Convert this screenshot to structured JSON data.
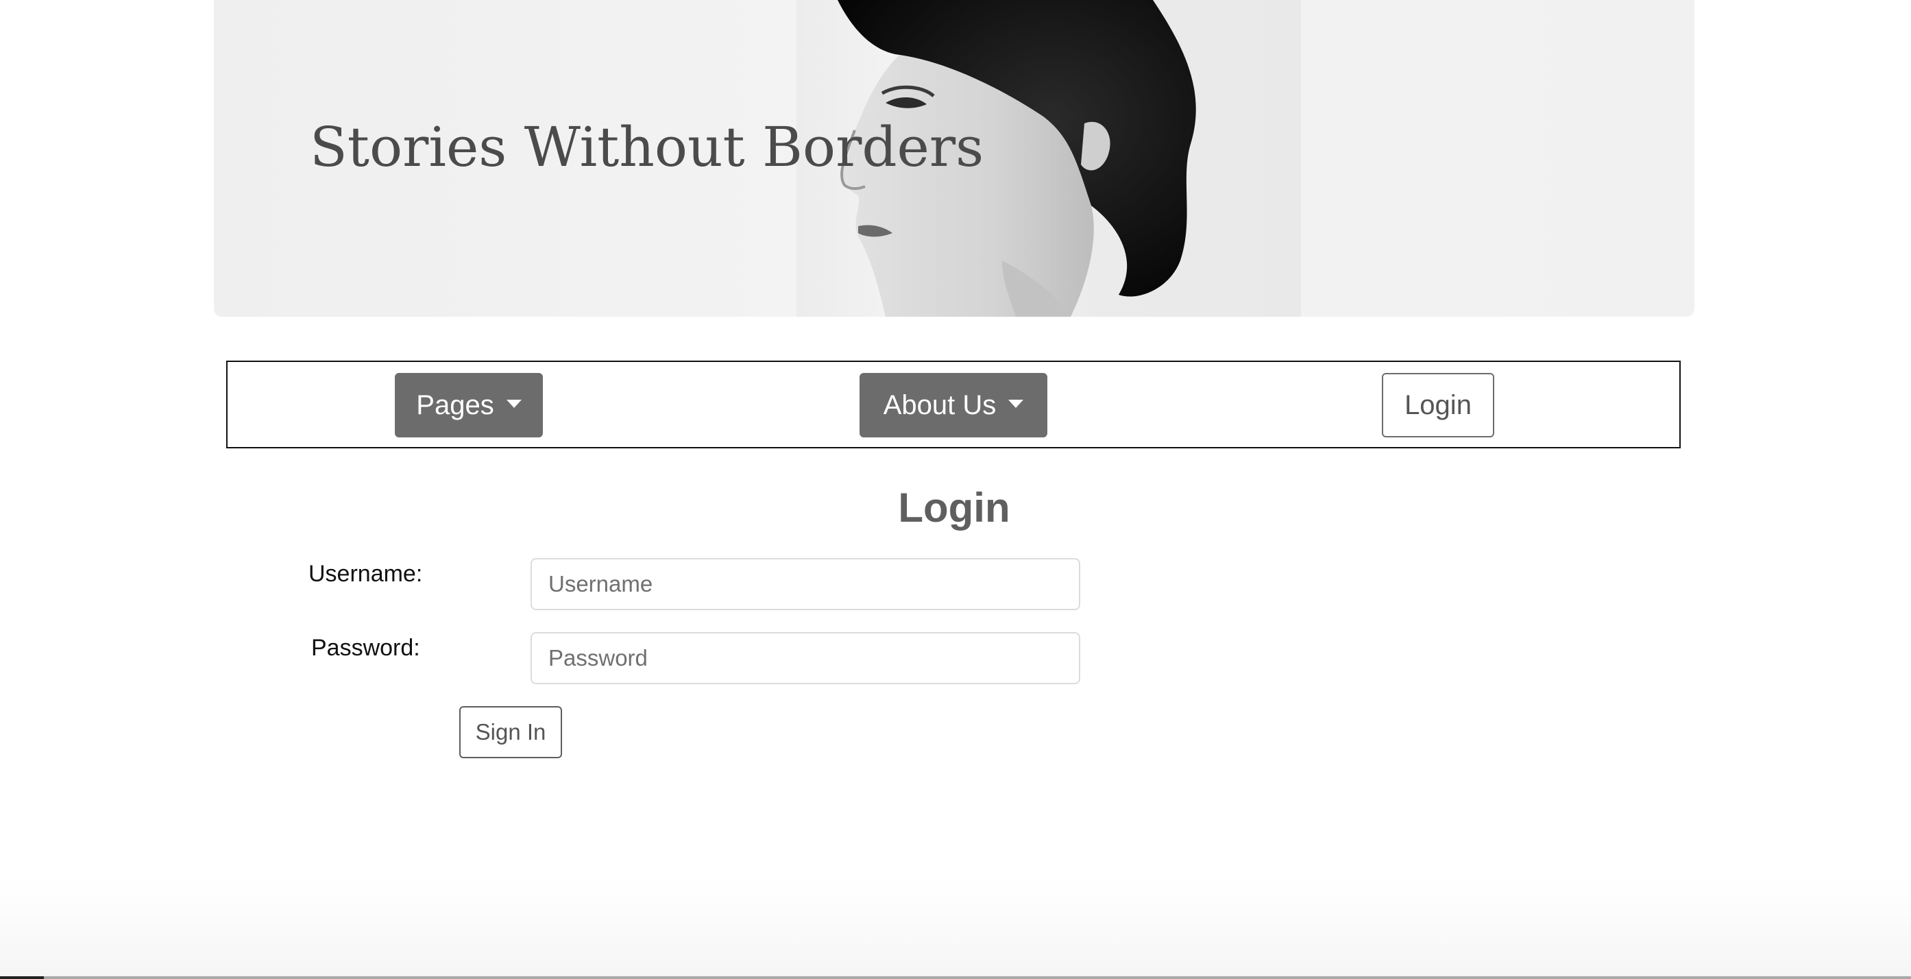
{
  "banner": {
    "title": "Stories Without Borders",
    "image": "portrait-photo"
  },
  "nav": {
    "pages_label": "Pages",
    "about_label": "About Us",
    "login_label": "Login"
  },
  "login_form": {
    "heading": "Login",
    "username_label": "Username:",
    "username_placeholder": "Username",
    "username_value": "",
    "password_label": "Password:",
    "password_placeholder": "Password",
    "password_value": "",
    "submit_label": "Sign In"
  },
  "colors": {
    "nav_button_bg": "#6c6c6c",
    "heading_color": "#5f5f5f",
    "title_color": "#4b4b4b"
  },
  "icons": {
    "dropdown": "caret-down-icon"
  }
}
